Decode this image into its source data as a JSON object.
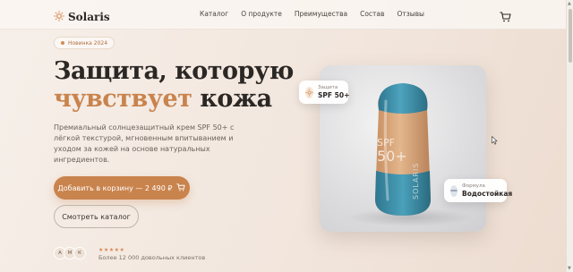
{
  "brand": {
    "name": "Solaris"
  },
  "nav": {
    "links": [
      "Каталог",
      "О продукте",
      "Преимущества",
      "Состав",
      "Отзывы"
    ]
  },
  "hero": {
    "badge": "Новинка 2024",
    "headline_line1": "Защита, которую",
    "headline_accent": "чувствует",
    "headline_rest": " кожа",
    "description": "Премиальный солнцезащитный крем SPF 50+ с лёгкой текстурой, мгновенным впитыванием и уходом за кожей на основе натуральных ингредиентов.",
    "primary_button": "Добавить в корзину — 2 490 ₽",
    "secondary_button": "Смотреть каталог",
    "avatars": [
      "А",
      "М",
      "К"
    ],
    "stars": "★★★★★",
    "social_proof": "Более 12 000 довольных клиентов"
  },
  "product": {
    "bottle_text_1": "SPF",
    "bottle_text_2": "50+",
    "bottle_side_text": "SOLARIS"
  },
  "floating_cards": {
    "protection": {
      "label": "Защита",
      "value": "SPF 50+"
    },
    "formula": {
      "label": "Формула",
      "value": "Водостойкая"
    }
  },
  "colors": {
    "accent": "#c9834d",
    "text": "#2b2724",
    "bottle_cap": "#3f8fa8",
    "bottle_body": "#d9a878"
  },
  "icons": {
    "logo": "sun-icon",
    "cart": "cart-icon",
    "protection": "sun-icon",
    "formula": "drop-icon"
  }
}
